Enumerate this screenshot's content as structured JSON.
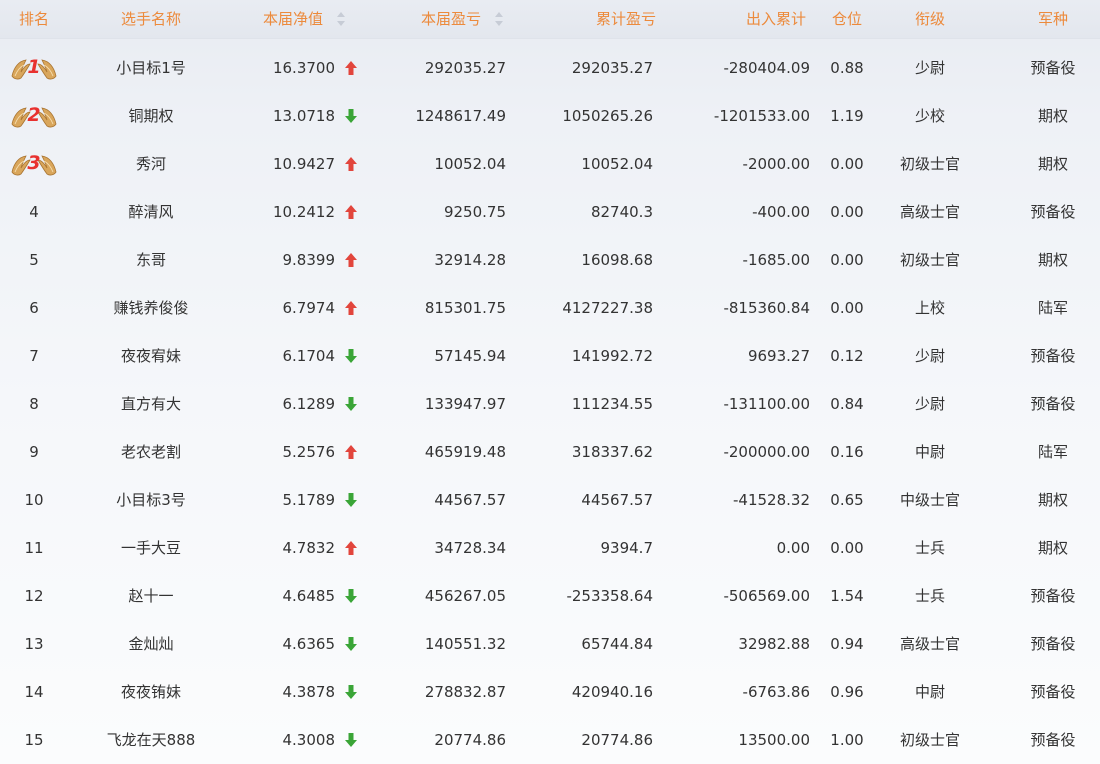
{
  "columns": {
    "rank": "排名",
    "name": "选手名称",
    "nav": "本届净值",
    "period_pnl": "本届盈亏",
    "cumulative_pnl": "累计盈亏",
    "inout": "出入累计",
    "position": "仓位",
    "level": "衔级",
    "arm": "军种"
  },
  "colors": {
    "header_text": "#ec8a3c",
    "up_arrow": "#e2453c",
    "down_arrow": "#3aa537",
    "medal_number": "#e8312f"
  },
  "rows": [
    {
      "rank": "1",
      "medal": true,
      "name": "小目标1号",
      "nav": "16.3700",
      "trend": "up",
      "period_pnl": "292035.27",
      "cumulative_pnl": "292035.27",
      "inout": "-280404.09",
      "position": "0.88",
      "level": "少尉",
      "arm": "预备役"
    },
    {
      "rank": "2",
      "medal": true,
      "name": "铜期权",
      "nav": "13.0718",
      "trend": "down",
      "period_pnl": "1248617.49",
      "cumulative_pnl": "1050265.26",
      "inout": "-1201533.00",
      "position": "1.19",
      "level": "少校",
      "arm": "期权"
    },
    {
      "rank": "3",
      "medal": true,
      "name": "秀河",
      "nav": "10.9427",
      "trend": "up",
      "period_pnl": "10052.04",
      "cumulative_pnl": "10052.04",
      "inout": "-2000.00",
      "position": "0.00",
      "level": "初级士官",
      "arm": "期权"
    },
    {
      "rank": "4",
      "medal": false,
      "name": "醉清风",
      "nav": "10.2412",
      "trend": "up",
      "period_pnl": "9250.75",
      "cumulative_pnl": "82740.3",
      "inout": "-400.00",
      "position": "0.00",
      "level": "高级士官",
      "arm": "预备役"
    },
    {
      "rank": "5",
      "medal": false,
      "name": "东哥",
      "nav": "9.8399",
      "trend": "up",
      "period_pnl": "32914.28",
      "cumulative_pnl": "16098.68",
      "inout": "-1685.00",
      "position": "0.00",
      "level": "初级士官",
      "arm": "期权"
    },
    {
      "rank": "6",
      "medal": false,
      "name": "赚钱养俊俊",
      "nav": "6.7974",
      "trend": "up",
      "period_pnl": "815301.75",
      "cumulative_pnl": "4127227.38",
      "inout": "-815360.84",
      "position": "0.00",
      "level": "上校",
      "arm": "陆军"
    },
    {
      "rank": "7",
      "medal": false,
      "name": "夜夜宥妹",
      "nav": "6.1704",
      "trend": "down",
      "period_pnl": "57145.94",
      "cumulative_pnl": "141992.72",
      "inout": "9693.27",
      "position": "0.12",
      "level": "少尉",
      "arm": "预备役"
    },
    {
      "rank": "8",
      "medal": false,
      "name": "直方有大",
      "nav": "6.1289",
      "trend": "down",
      "period_pnl": "133947.97",
      "cumulative_pnl": "111234.55",
      "inout": "-131100.00",
      "position": "0.84",
      "level": "少尉",
      "arm": "预备役"
    },
    {
      "rank": "9",
      "medal": false,
      "name": "老农老割",
      "nav": "5.2576",
      "trend": "up",
      "period_pnl": "465919.48",
      "cumulative_pnl": "318337.62",
      "inout": "-200000.00",
      "position": "0.16",
      "level": "中尉",
      "arm": "陆军"
    },
    {
      "rank": "10",
      "medal": false,
      "name": "小目标3号",
      "nav": "5.1789",
      "trend": "down",
      "period_pnl": "44567.57",
      "cumulative_pnl": "44567.57",
      "inout": "-41528.32",
      "position": "0.65",
      "level": "中级士官",
      "arm": "期权"
    },
    {
      "rank": "11",
      "medal": false,
      "name": "一手大豆",
      "nav": "4.7832",
      "trend": "up",
      "period_pnl": "34728.34",
      "cumulative_pnl": "9394.7",
      "inout": "0.00",
      "position": "0.00",
      "level": "士兵",
      "arm": "期权"
    },
    {
      "rank": "12",
      "medal": false,
      "name": "赵十一",
      "nav": "4.6485",
      "trend": "down",
      "period_pnl": "456267.05",
      "cumulative_pnl": "-253358.64",
      "inout": "-506569.00",
      "position": "1.54",
      "level": "士兵",
      "arm": "预备役"
    },
    {
      "rank": "13",
      "medal": false,
      "name": "金灿灿",
      "nav": "4.6365",
      "trend": "down",
      "period_pnl": "140551.32",
      "cumulative_pnl": "65744.84",
      "inout": "32982.88",
      "position": "0.94",
      "level": "高级士官",
      "arm": "预备役"
    },
    {
      "rank": "14",
      "medal": false,
      "name": "夜夜铕妹",
      "nav": "4.3878",
      "trend": "down",
      "period_pnl": "278832.87",
      "cumulative_pnl": "420940.16",
      "inout": "-6763.86",
      "position": "0.96",
      "level": "中尉",
      "arm": "预备役"
    },
    {
      "rank": "15",
      "medal": false,
      "name": "飞龙在天888",
      "nav": "4.3008",
      "trend": "down",
      "period_pnl": "20774.86",
      "cumulative_pnl": "20774.86",
      "inout": "13500.00",
      "position": "1.00",
      "level": "初级士官",
      "arm": "预备役"
    }
  ]
}
